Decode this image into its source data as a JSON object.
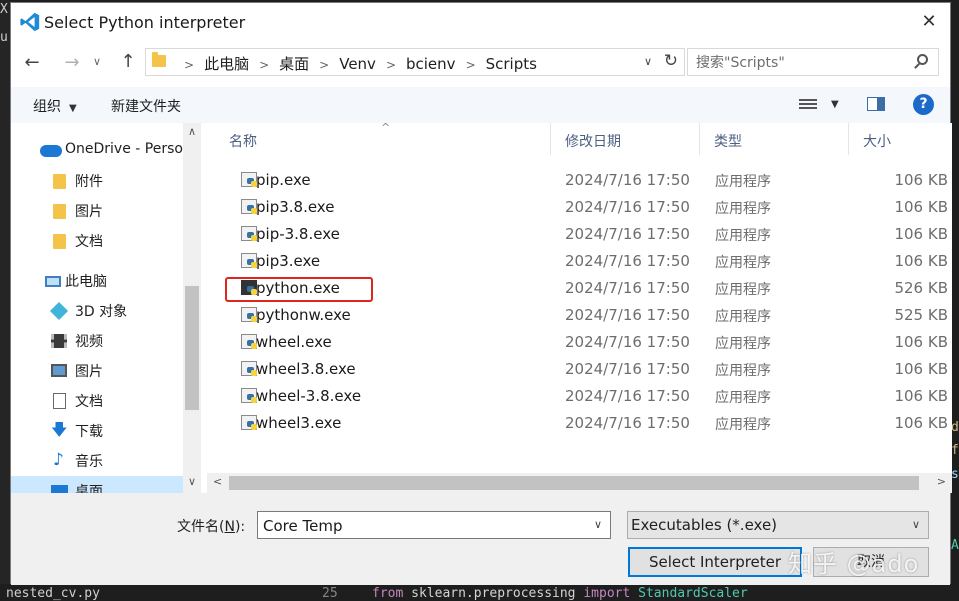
{
  "background": {
    "file_tab": "nested_cv.py",
    "line_number": "25",
    "code_keyword_from": "from",
    "code_module": "sklearn.preprocessing",
    "code_keyword_import": "import",
    "code_class": "StandardScaler",
    "edge_chars": [
      "X",
      "u",
      "d",
      "f",
      "s",
      "A"
    ]
  },
  "dialog": {
    "title": "Select Python interpreter",
    "close_glyph": "✕"
  },
  "nav": {
    "breadcrumbs": [
      "此电脑",
      "桌面",
      "Venv",
      "bcienv",
      "Scripts"
    ],
    "search_placeholder": "搜索\"Scripts\""
  },
  "toolbar": {
    "organize": "组织",
    "new_folder": "新建文件夹",
    "help": "?"
  },
  "tree": {
    "items": [
      {
        "label": "OneDrive - Perso",
        "icon": "cloud"
      },
      {
        "label": "附件",
        "icon": "folder"
      },
      {
        "label": "图片",
        "icon": "folder"
      },
      {
        "label": "文档",
        "icon": "folder"
      },
      {
        "label": "此电脑",
        "icon": "pc"
      },
      {
        "label": "3D 对象",
        "icon": "3d"
      },
      {
        "label": "视频",
        "icon": "video"
      },
      {
        "label": "图片",
        "icon": "picture"
      },
      {
        "label": "文档",
        "icon": "document"
      },
      {
        "label": "下载",
        "icon": "download"
      },
      {
        "label": "音乐",
        "icon": "music"
      },
      {
        "label": "桌面",
        "icon": "desktop"
      }
    ]
  },
  "columns": {
    "name": "名称",
    "date": "修改日期",
    "type": "类型",
    "size": "大小"
  },
  "files": [
    {
      "name": "pip.exe",
      "date": "2024/7/16 17:50",
      "type": "应用程序",
      "size": "106 KB"
    },
    {
      "name": "pip3.8.exe",
      "date": "2024/7/16 17:50",
      "type": "应用程序",
      "size": "106 KB"
    },
    {
      "name": "pip-3.8.exe",
      "date": "2024/7/16 17:50",
      "type": "应用程序",
      "size": "106 KB"
    },
    {
      "name": "pip3.exe",
      "date": "2024/7/16 17:50",
      "type": "应用程序",
      "size": "106 KB"
    },
    {
      "name": "python.exe",
      "date": "2024/7/16 17:50",
      "type": "应用程序",
      "size": "526 KB"
    },
    {
      "name": "pythonw.exe",
      "date": "2024/7/16 17:50",
      "type": "应用程序",
      "size": "525 KB"
    },
    {
      "name": "wheel.exe",
      "date": "2024/7/16 17:50",
      "type": "应用程序",
      "size": "106 KB"
    },
    {
      "name": "wheel3.8.exe",
      "date": "2024/7/16 17:50",
      "type": "应用程序",
      "size": "106 KB"
    },
    {
      "name": "wheel-3.8.exe",
      "date": "2024/7/16 17:50",
      "type": "应用程序",
      "size": "106 KB"
    },
    {
      "name": "wheel3.exe",
      "date": "2024/7/16 17:50",
      "type": "应用程序",
      "size": "106 KB"
    }
  ],
  "footer": {
    "filename_label": "文件名(",
    "filename_hotkey": "N",
    "filename_label_end": "):",
    "filename_value": "Core Temp",
    "filetype": "Executables (*.exe)",
    "select_button": "Select Interpreter",
    "cancel_button": "取消"
  },
  "watermark": "知乎 @ado",
  "colors": {
    "accent": "#0078d7",
    "highlight": "#e0261c",
    "selected_tree": "#cce8ff",
    "folder": "#f4c34a"
  }
}
